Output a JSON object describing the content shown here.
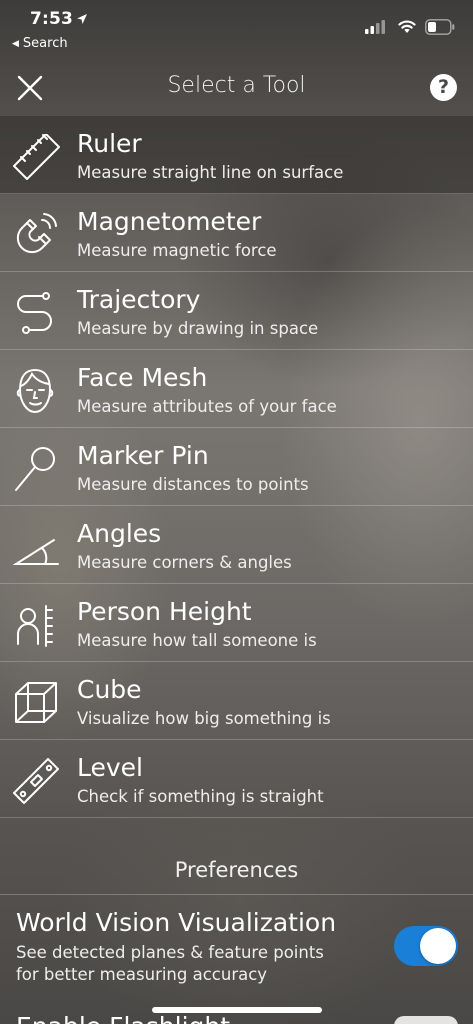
{
  "status_bar": {
    "time": "7:53",
    "back_label": "Search"
  },
  "nav": {
    "title": "Select a Tool",
    "help_label": "?"
  },
  "tools": [
    {
      "name": "Ruler",
      "description": "Measure straight line on surface",
      "icon": "ruler-icon",
      "selected": true
    },
    {
      "name": "Magnetometer",
      "description": "Measure magnetic force",
      "icon": "magnet-icon"
    },
    {
      "name": "Trajectory",
      "description": "Measure by drawing in space",
      "icon": "trajectory-icon"
    },
    {
      "name": "Face Mesh",
      "description": "Measure attributes of your face",
      "icon": "face-icon"
    },
    {
      "name": "Marker Pin",
      "description": "Measure distances to points",
      "icon": "marker-pin-icon"
    },
    {
      "name": "Angles",
      "description": "Measure corners & angles",
      "icon": "angle-icon"
    },
    {
      "name": "Person Height",
      "description": "Measure how tall someone is",
      "icon": "person-height-icon"
    },
    {
      "name": "Cube",
      "description": "Visualize how big something is",
      "icon": "cube-icon"
    },
    {
      "name": "Level",
      "description": "Check if something is straight",
      "icon": "level-icon"
    }
  ],
  "preferences": {
    "header": "Preferences",
    "items": [
      {
        "name": "World Vision Visualization",
        "description": "See detected planes & feature points for better measuring accuracy",
        "enabled": true
      },
      {
        "name": "Enable Flashlight"
      }
    ]
  },
  "colors": {
    "toggle_on": "#1a7fd6"
  }
}
